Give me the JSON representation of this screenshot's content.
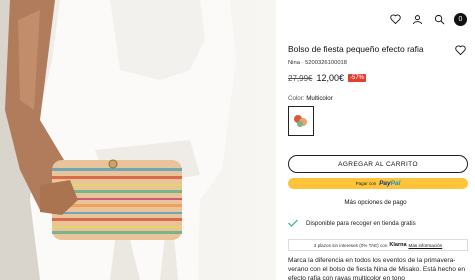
{
  "header": {
    "icons": [
      "heart-icon",
      "user-icon",
      "search-icon",
      "bag-icon"
    ],
    "cart_count": "0"
  },
  "product": {
    "title": "Bolso de fiesta pequeño efecto rafia",
    "reference": "Nina · 5200326100018",
    "old_price": "27,99€",
    "new_price": "12,00€",
    "discount": "-57%",
    "color_label": "Color:",
    "color_value": "Multicolor"
  },
  "actions": {
    "add_to_cart": "AGREGAR AL CARRITO",
    "paypal_prefix": "Pagar con",
    "paypal_brand_a": "Pay",
    "paypal_brand_b": "Pal",
    "more_payment": "Más opciones de pago"
  },
  "pickup": {
    "text": "Disponible para recoger en tienda gratis"
  },
  "klarna": {
    "prefix": "3 plazos sin intereses (0% TAE) con",
    "brand": "Klarna",
    "link": "Más información"
  },
  "description": "Marca la diferencia en todos los eventos de la primavera-verano con el bolso de fiesta Nina de Misako. Está hecho en efecto rafia con rayas multicolor en tono"
}
